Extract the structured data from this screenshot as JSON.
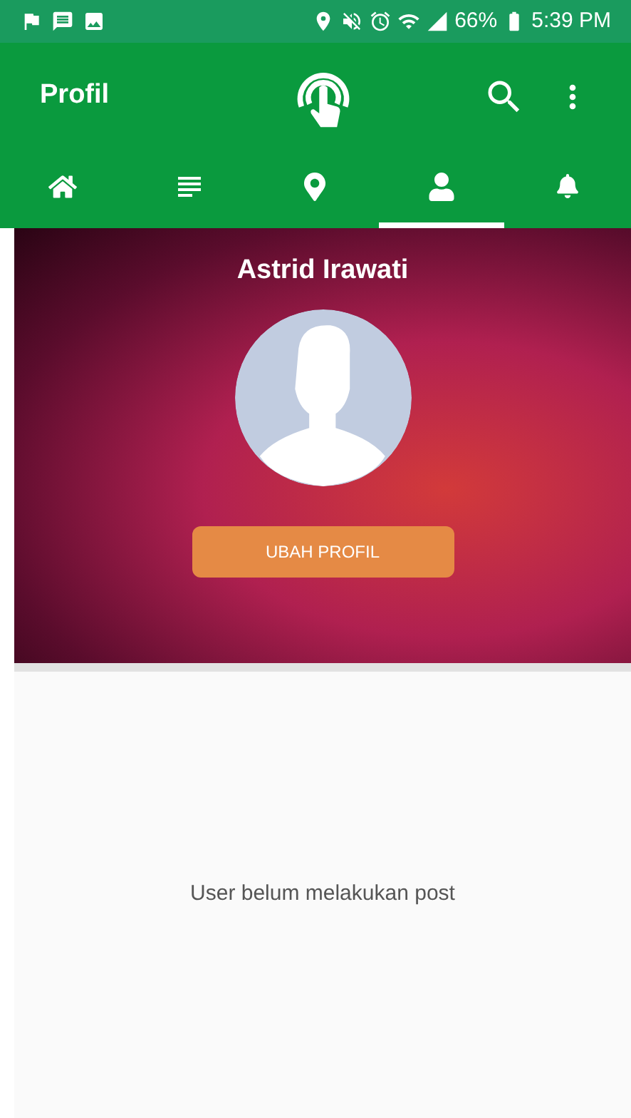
{
  "status_bar": {
    "battery": "66%",
    "time": "5:39 PM"
  },
  "toolbar": {
    "title": "Profil"
  },
  "tabs": [
    {
      "kind": "home",
      "selected": false
    },
    {
      "kind": "list",
      "selected": false
    },
    {
      "kind": "pin",
      "selected": false
    },
    {
      "kind": "person",
      "selected": true
    },
    {
      "kind": "bell",
      "selected": false
    }
  ],
  "profile": {
    "name": "Astrid Irawati",
    "button": "UBAH PROFIL"
  },
  "posts": {
    "empty_message": "User belum melakukan post"
  }
}
